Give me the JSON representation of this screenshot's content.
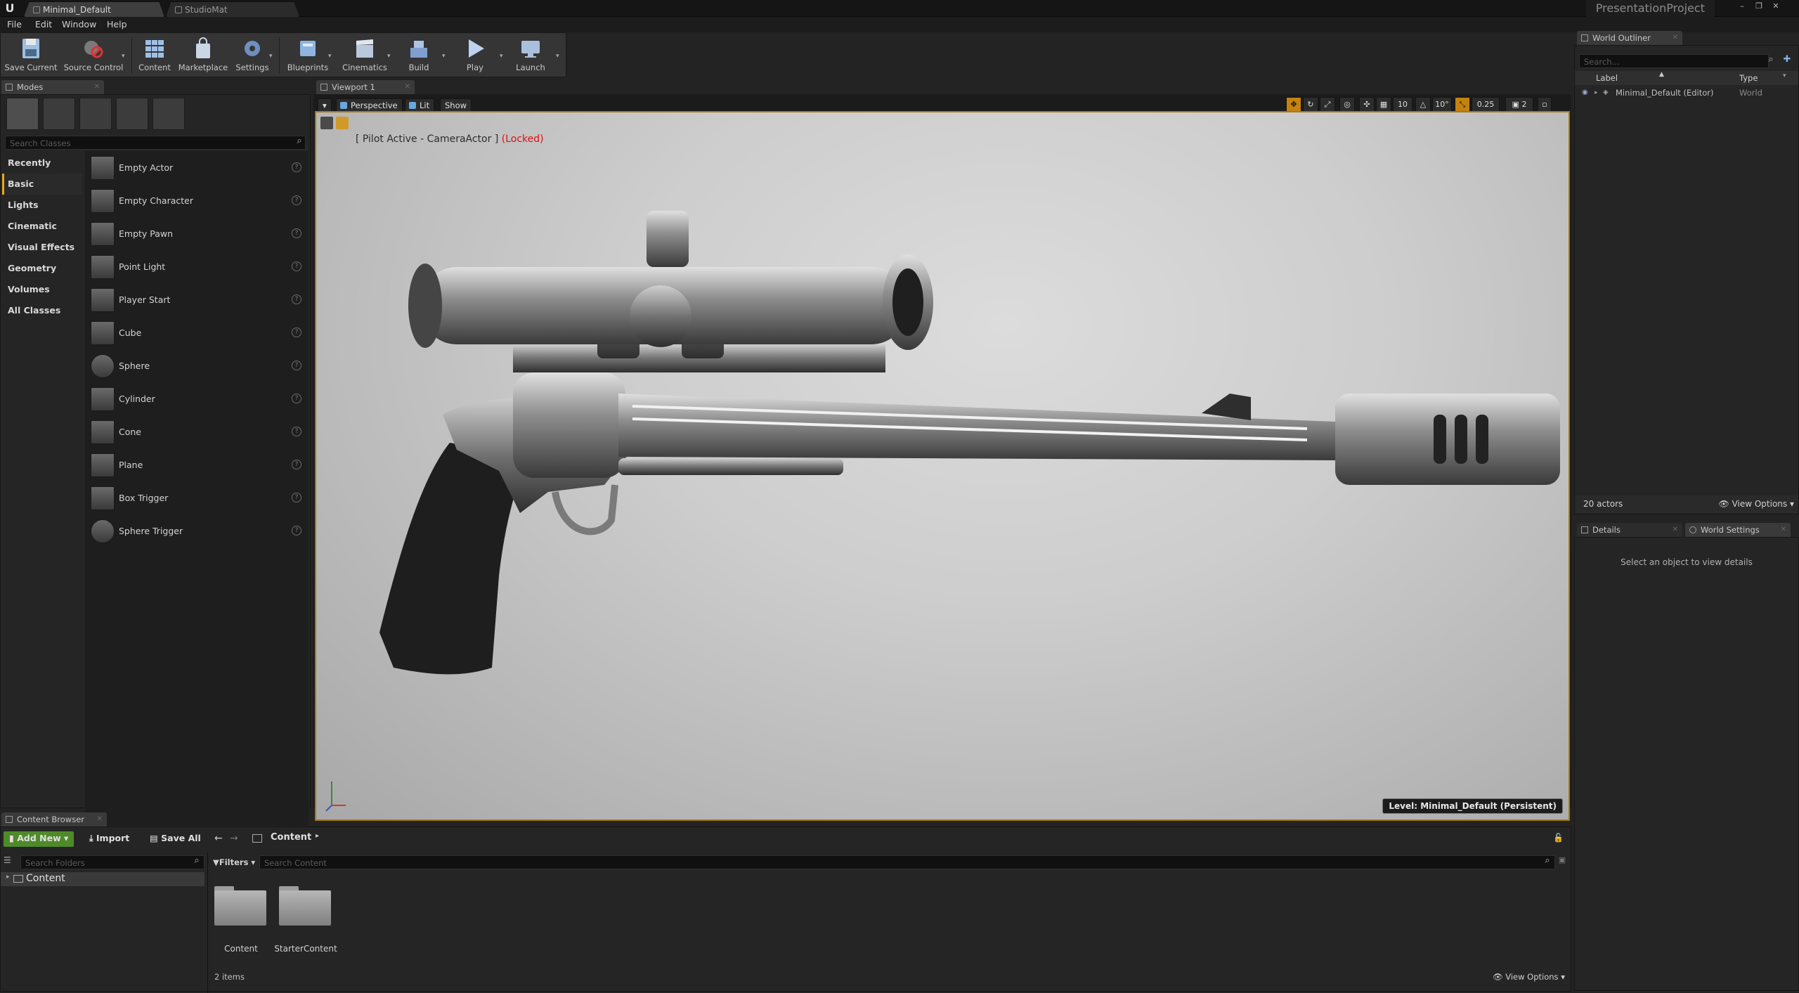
{
  "title_bar": {
    "tabs": [
      "Minimal_Default",
      "StudioMat"
    ],
    "project_name": "PresentationProject"
  },
  "menu": [
    "File",
    "Edit",
    "Window",
    "Help"
  ],
  "toolbar": [
    "Save Current",
    "Source Control",
    "Content",
    "Marketplace",
    "Settings",
    "Blueprints",
    "Cinematics",
    "Build",
    "Play",
    "Launch"
  ],
  "modes": {
    "tab": "Modes",
    "search_placeholder": "Search Classes",
    "categories": [
      "Recently Placed",
      "Basic",
      "Lights",
      "Cinematic",
      "Visual Effects",
      "Geometry",
      "Volumes",
      "All Classes"
    ],
    "selected_category": "Basic",
    "classes": [
      "Empty Actor",
      "Empty Character",
      "Empty Pawn",
      "Point Light",
      "Player Start",
      "Cube",
      "Sphere",
      "Cylinder",
      "Cone",
      "Plane",
      "Box Trigger",
      "Sphere Trigger"
    ]
  },
  "viewport": {
    "tab": "Viewport 1",
    "perspective": "Perspective",
    "lit": "Lit",
    "show": "Show",
    "pilot_text": "[ Pilot Active - CameraActor ]",
    "locked_text": "(Locked)",
    "grid_snap": "10",
    "rot_snap": "10°",
    "scale_snap": "0.25",
    "cam_speed": "2",
    "level_label": "Level:  Minimal_Default (Persistent)"
  },
  "outliner": {
    "tab": "World Outliner",
    "search_placeholder": "Search...",
    "col_label": "Label",
    "col_type": "Type",
    "rows": [
      {
        "label": "Minimal_Default (Editor)",
        "type": "World"
      }
    ],
    "actor_count": "20 actors",
    "view_options": "View Options"
  },
  "details": {
    "tab_details": "Details",
    "tab_world": "World Settings",
    "empty_msg": "Select an object to view details"
  },
  "content_browser": {
    "tab": "Content Browser",
    "add_new": "Add New",
    "import": "Import",
    "save_all": "Save All",
    "path": "Content",
    "search_folders": "Search Folders",
    "filters": "Filters",
    "search_content": "Search Content",
    "tree_root": "Content",
    "items": [
      "Content",
      "StarterContent"
    ],
    "item_count": "2 items",
    "view_options": "View Options"
  },
  "colors": {
    "accent": "#e8a71c",
    "locked": "#dd1111",
    "add_new": "#5a9a2c"
  }
}
